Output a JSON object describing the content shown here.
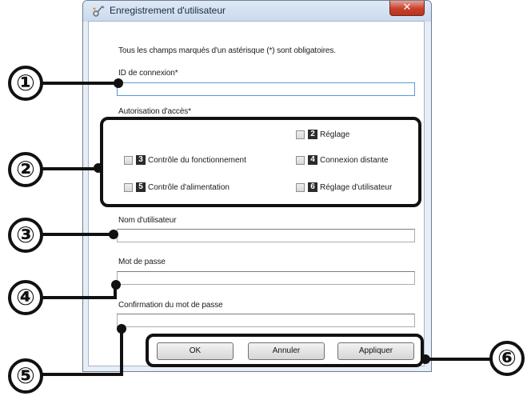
{
  "window": {
    "title": "Enregistrement d'utilisateur",
    "close_symbol": "✕"
  },
  "form": {
    "intro": "Tous les champs marqués d'un astérisque (*) sont obligatoires.",
    "login_id_label": "ID de connexion*",
    "login_id_value": "",
    "access_label": "Autorisation d'accès*",
    "permissions": [
      {
        "num": "2",
        "label": "Réglage",
        "checked": false
      },
      {
        "num": "3",
        "label": "Contrôle du fonctionnement",
        "checked": false
      },
      {
        "num": "4",
        "label": "Connexion distante",
        "checked": false
      },
      {
        "num": "5",
        "label": "Contrôle d'alimentation",
        "checked": false
      },
      {
        "num": "6",
        "label": "Réglage d'utilisateur",
        "checked": false
      }
    ],
    "username_label": "Nom d'utilisateur",
    "username_value": "",
    "password_label": "Mot de passe",
    "password_value": "",
    "confirm_label": "Confirmation du mot de passe",
    "confirm_value": ""
  },
  "buttons": {
    "ok": "OK",
    "cancel": "Annuler",
    "apply": "Appliquer"
  },
  "callouts": [
    "①",
    "②",
    "③",
    "④",
    "⑤",
    "⑥"
  ]
}
